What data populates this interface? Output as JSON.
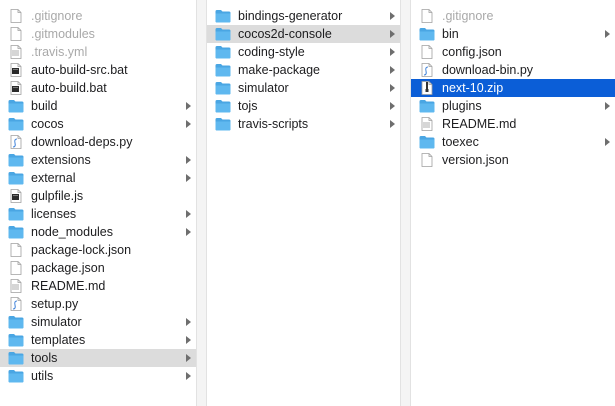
{
  "columns": [
    {
      "items": [
        {
          "label": ".gitignore",
          "type": "file-blank",
          "hidden": true
        },
        {
          "label": ".gitmodules",
          "type": "file-blank",
          "hidden": true
        },
        {
          "label": ".travis.yml",
          "type": "file-doc",
          "hidden": true
        },
        {
          "label": "auto-build-src.bat",
          "type": "file-exec"
        },
        {
          "label": "auto-build.bat",
          "type": "file-exec"
        },
        {
          "label": "build",
          "type": "folder",
          "arrow": true
        },
        {
          "label": "cocos",
          "type": "folder",
          "arrow": true
        },
        {
          "label": "download-deps.py",
          "type": "file-script"
        },
        {
          "label": "extensions",
          "type": "folder",
          "arrow": true
        },
        {
          "label": "external",
          "type": "folder",
          "arrow": true
        },
        {
          "label": "gulpfile.js",
          "type": "file-exec"
        },
        {
          "label": "licenses",
          "type": "folder",
          "arrow": true
        },
        {
          "label": "node_modules",
          "type": "folder",
          "arrow": true
        },
        {
          "label": "package-lock.json",
          "type": "file-blank"
        },
        {
          "label": "package.json",
          "type": "file-blank"
        },
        {
          "label": "README.md",
          "type": "file-doc"
        },
        {
          "label": "setup.py",
          "type": "file-script"
        },
        {
          "label": "simulator",
          "type": "folder",
          "arrow": true
        },
        {
          "label": "templates",
          "type": "folder",
          "arrow": true
        },
        {
          "label": "tools",
          "type": "folder",
          "arrow": true,
          "selected": "gray"
        },
        {
          "label": "utils",
          "type": "folder",
          "arrow": true
        }
      ]
    },
    {
      "items": [
        {
          "label": "bindings-generator",
          "type": "folder",
          "arrow": true
        },
        {
          "label": "cocos2d-console",
          "type": "folder",
          "arrow": true,
          "selected": "gray"
        },
        {
          "label": "coding-style",
          "type": "folder",
          "arrow": true
        },
        {
          "label": "make-package",
          "type": "folder",
          "arrow": true
        },
        {
          "label": "simulator",
          "type": "folder",
          "arrow": true
        },
        {
          "label": "tojs",
          "type": "folder",
          "arrow": true
        },
        {
          "label": "travis-scripts",
          "type": "folder",
          "arrow": true
        }
      ]
    },
    {
      "items": [
        {
          "label": ".gitignore",
          "type": "file-blank",
          "hidden": true
        },
        {
          "label": "bin",
          "type": "folder",
          "arrow": true
        },
        {
          "label": "config.json",
          "type": "file-blank"
        },
        {
          "label": "download-bin.py",
          "type": "file-script"
        },
        {
          "label": "next-10.zip",
          "type": "file-zip",
          "selected": "blue"
        },
        {
          "label": "plugins",
          "type": "folder",
          "arrow": true
        },
        {
          "label": "README.md",
          "type": "file-doc"
        },
        {
          "label": "toexec",
          "type": "folder",
          "arrow": true
        },
        {
          "label": "version.json",
          "type": "file-blank"
        }
      ]
    }
  ],
  "colors": {
    "folder": "#5fb8ef",
    "folder_tab": "#4aa6e3",
    "selection_blue": "#0b5ed7",
    "selection_gray": "#dcdcdc"
  }
}
